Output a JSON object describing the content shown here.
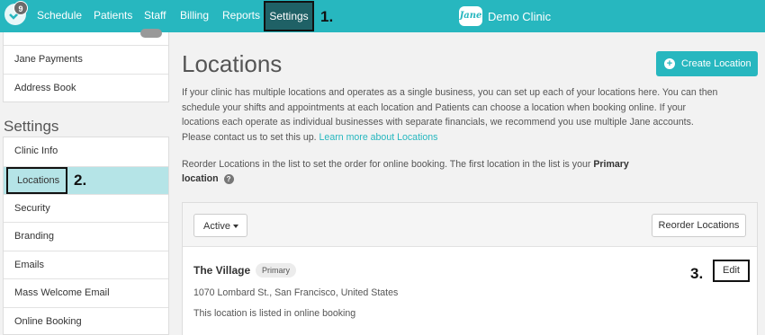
{
  "nav": {
    "notification_count": "9",
    "items": [
      "Schedule",
      "Patients",
      "Staff",
      "Billing",
      "Reports",
      "Settings"
    ],
    "brand_mark": "Jane",
    "clinic_name": "Demo Clinic"
  },
  "callouts": [
    "1.",
    "2.",
    "3."
  ],
  "sidebar": {
    "top_items": [
      "Jane Payments",
      "Address Book"
    ],
    "section_title": "Settings",
    "menu": [
      "Clinic Info",
      "Locations",
      "Security",
      "Branding",
      "Emails",
      "Mass Welcome Email",
      "Online Booking"
    ]
  },
  "main": {
    "title": "Locations",
    "create_button": "Create Location",
    "description": "If your clinic has multiple locations and operates as a single business, you can set up each of your locations here. You can then schedule your shifts and appointments at each location and Patients can choose a location when booking online. If your locations each operate as individual businesses with separate financials, we recommend you use multiple Jane accounts. Please contact us to set this up.",
    "learn_more_link": "Learn more about Locations",
    "reorder_note": "Reorder Locations in the list to set the order for online booking. The first location in the list is your",
    "reorder_note_bold": "Primary location",
    "filter_label": "Active",
    "reorder_button": "Reorder Locations",
    "location": {
      "name": "The Village",
      "badge": "Primary",
      "address": "1070 Lombard St., San Francisco, United States",
      "booking_status": "This location is listed in online booking",
      "edit_button": "Edit"
    }
  },
  "colors": {
    "accent": "#27b7bf",
    "active_menu": "#b5e4e7",
    "settings_tab": "#1f6166"
  }
}
